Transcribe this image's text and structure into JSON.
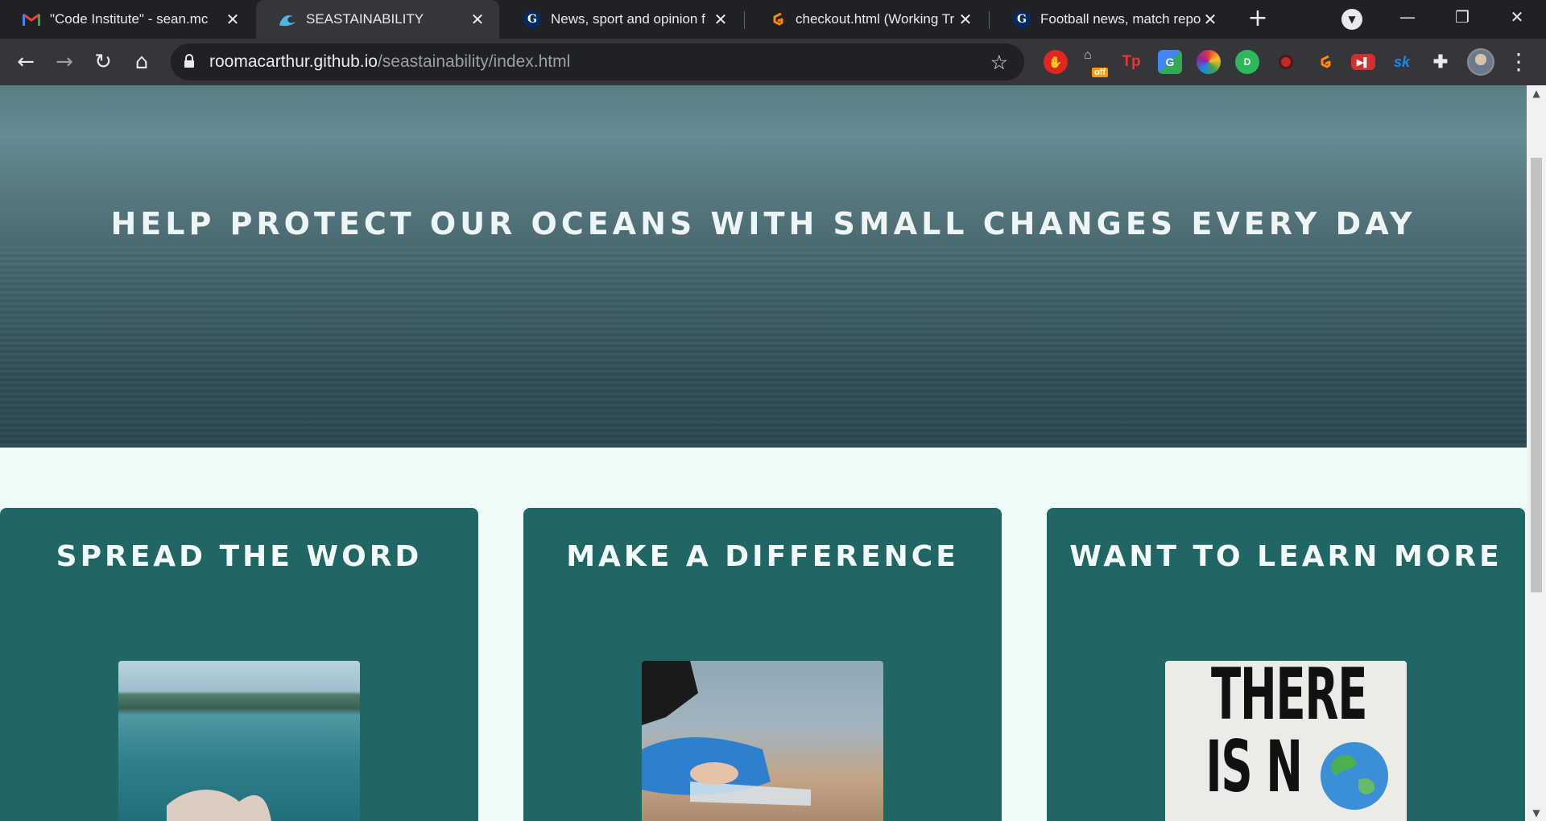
{
  "tabs": [
    {
      "title": "\"Code Institute\" - sean.mc",
      "icon": "gmail-icon"
    },
    {
      "title": "SEASTAINABILITY",
      "icon": "wave-icon"
    },
    {
      "title": "News, sport and opinion f",
      "icon": "guardian-icon"
    },
    {
      "title": "checkout.html (Working Tr",
      "icon": "gitpod-icon"
    },
    {
      "title": "Football news, match repo",
      "icon": "guardian-icon"
    }
  ],
  "toolbar": {
    "url_host": "roomacarthur.github.io",
    "url_path": "/seastainability/index.html"
  },
  "extensions": {
    "off_badge": "off",
    "tp": "Tp",
    "sk": "sk"
  },
  "page": {
    "hero_title": "HELP PROTECT OUR OCEANS WITH SMALL CHANGES EVERY DAY",
    "cards": [
      {
        "title": "SPREAD THE WORD"
      },
      {
        "title": "MAKE A DIFFERENCE"
      },
      {
        "title": "WANT TO LEARN MORE"
      }
    ],
    "book_cover_lines": [
      "THERE",
      "IS N"
    ]
  },
  "colors": {
    "card_bg": "#206664",
    "page_bg": "#effdfa",
    "chrome_dark": "#202124",
    "chrome_toolbar": "#35363a"
  }
}
